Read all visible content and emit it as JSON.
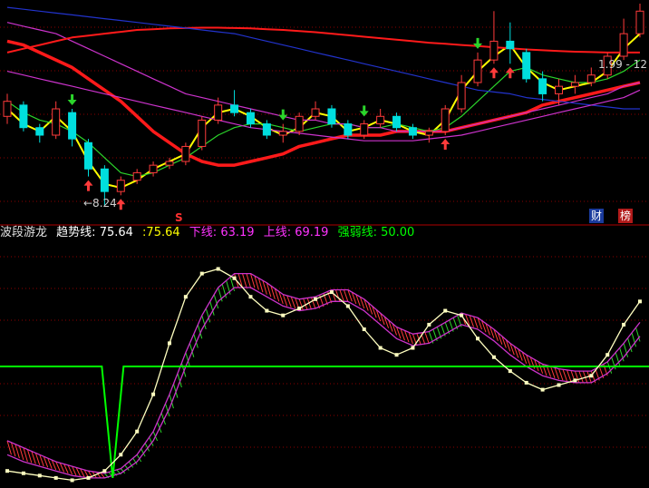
{
  "indicator": {
    "name": "波段游龙",
    "trend_label": "趋势线:",
    "trend_value": "75.64",
    "trend_value2": ":75.64",
    "lower_label": "下线:",
    "lower_value": "63.19",
    "upper_label": "上线:",
    "upper_value": "69.19",
    "strength_label": "强弱线:",
    "strength_value": "50.00"
  },
  "badges": {
    "cai": "财",
    "bang": "榜"
  },
  "price_panel": {
    "low_annotation": "←8.24",
    "right_annotation": "1.99 - 12",
    "s_marker": "S"
  },
  "colors": {
    "background": "#000000",
    "grid_red": "#8b0000",
    "ma_red": "#ff1a1a",
    "ma_yellow": "#ffff00",
    "ma_green": "#2bd52b",
    "ma_magenta": "#cc33cc",
    "ma_blue": "#2233cc",
    "up_candle": "#ff3b3b",
    "down_candle": "#00dede",
    "trend_line": "#ffffc0",
    "band": "#cc33cc",
    "strength_line": "#00ff00"
  },
  "chart_data": [
    {
      "type": "line",
      "title": "",
      "series": [
        {
          "values": [
            12.6,
            12.5,
            12.3,
            12.1,
            11.9,
            11.6,
            11.3,
            11.0,
            10.6,
            10.2,
            9.9,
            9.6,
            9.4,
            9.3,
            9.3,
            9.4,
            9.5,
            9.6,
            9.8,
            9.9,
            10.0,
            10.1,
            10.1,
            10.1,
            10.2,
            10.2,
            10.2,
            10.2,
            10.3,
            10.4,
            10.5,
            10.6,
            10.7,
            10.9,
            11.0,
            11.1,
            11.2,
            11.3,
            11.4,
            11.5
          ]
        },
        {
          "values": [
            10.8,
            10.4,
            10.2,
            10.6,
            10.2,
            9.4,
            8.8,
            8.7,
            8.9,
            9.2,
            9.4,
            9.6,
            10.3,
            10.7,
            10.8,
            10.6,
            10.3,
            10.1,
            10.3,
            10.7,
            10.6,
            10.2,
            10.3,
            10.5,
            10.4,
            10.2,
            10.1,
            10.5,
            11.3,
            11.8,
            12.2,
            12.5,
            11.9,
            11.5,
            11.3,
            11.4,
            11.5,
            11.8,
            12.4,
            12.8
          ]
        },
        {
          "values": [
            11.0,
            10.7,
            10.5,
            10.4,
            10.2,
            9.9,
            9.5,
            9.1,
            9.0,
            9.1,
            9.3,
            9.5,
            9.8,
            10.1,
            10.3,
            10.4,
            10.4,
            10.3,
            10.2,
            10.3,
            10.4,
            10.4,
            10.3,
            10.3,
            10.4,
            10.3,
            10.2,
            10.3,
            10.6,
            11.0,
            11.4,
            11.8,
            11.9,
            11.7,
            11.6,
            11.5,
            11.5,
            11.6,
            11.8,
            12.1
          ]
        },
        {
          "values": [
            13.1,
            13.0,
            12.9,
            12.8,
            12.6,
            12.4,
            12.2,
            12.0,
            11.8,
            11.6,
            11.4,
            11.2,
            11.1,
            11.0,
            10.9,
            10.8,
            10.7,
            10.6,
            10.5,
            10.5,
            10.4,
            10.4,
            10.3,
            10.3,
            10.2,
            10.2,
            10.2,
            10.2,
            10.3,
            10.4,
            10.5,
            10.6,
            10.7,
            10.8,
            10.9,
            11.0,
            11.1,
            11.2,
            11.4,
            11.5
          ]
        },
        {
          "values": [
            12.3,
            12.4,
            12.5,
            12.6,
            12.7,
            12.75,
            12.8,
            12.85,
            12.9,
            12.92,
            12.94,
            12.95,
            12.96,
            12.96,
            12.95,
            12.94,
            12.92,
            12.9,
            12.87,
            12.84,
            12.8,
            12.76,
            12.72,
            12.68,
            12.64,
            12.6,
            12.56,
            12.53,
            12.5,
            12.47,
            12.44,
            12.41,
            12.38,
            12.36,
            12.34,
            12.32,
            12.31,
            12.3,
            12.3,
            12.3
          ]
        },
        {
          "values": [
            13.5,
            13.45,
            13.4,
            13.35,
            13.3,
            13.25,
            13.2,
            13.15,
            13.1,
            13.05,
            13.0,
            12.95,
            12.9,
            12.85,
            12.8,
            12.7,
            12.6,
            12.5,
            12.4,
            12.3,
            12.2,
            12.1,
            12.0,
            11.9,
            11.8,
            11.7,
            11.6,
            11.5,
            11.4,
            11.3,
            11.25,
            11.2,
            11.1,
            11.05,
            11.0,
            10.95,
            10.9,
            10.85,
            10.8,
            10.8
          ]
        },
        {
          "values": [
            11.8,
            11.7,
            11.6,
            11.5,
            11.4,
            11.3,
            11.2,
            11.1,
            11.0,
            10.9,
            10.8,
            10.7,
            10.6,
            10.5,
            10.4,
            10.3,
            10.25,
            10.2,
            10.15,
            10.1,
            10.05,
            10.0,
            9.95,
            9.95,
            9.95,
            9.95,
            10.0,
            10.05,
            10.1,
            10.2,
            10.3,
            10.4,
            10.5,
            10.6,
            10.7,
            10.8,
            10.9,
            11.0,
            11.1,
            11.3
          ]
        }
      ],
      "candles": [
        {
          "o": 10.6,
          "c": 11.0,
          "h": 11.2,
          "l": 10.4
        },
        {
          "o": 10.9,
          "c": 10.3,
          "h": 11.0,
          "l": 10.2
        },
        {
          "o": 10.3,
          "c": 10.1,
          "h": 10.4,
          "l": 9.9
        },
        {
          "o": 10.1,
          "c": 10.8,
          "h": 11.0,
          "l": 10.0
        },
        {
          "o": 10.7,
          "c": 10.0,
          "h": 10.8,
          "l": 9.8
        },
        {
          "o": 9.9,
          "c": 9.2,
          "h": 10.0,
          "l": 9.0
        },
        {
          "o": 9.2,
          "c": 8.6,
          "h": 9.3,
          "l": 8.24
        },
        {
          "o": 8.6,
          "c": 8.9,
          "h": 9.0,
          "l": 8.5
        },
        {
          "o": 8.9,
          "c": 9.1,
          "h": 9.2,
          "l": 8.8
        },
        {
          "o": 9.1,
          "c": 9.3,
          "h": 9.4,
          "l": 9.0
        },
        {
          "o": 9.3,
          "c": 9.4,
          "h": 9.5,
          "l": 9.2
        },
        {
          "o": 9.4,
          "c": 9.8,
          "h": 9.9,
          "l": 9.3
        },
        {
          "o": 9.8,
          "c": 10.5,
          "h": 10.6,
          "l": 9.7
        },
        {
          "o": 10.5,
          "c": 10.9,
          "h": 11.1,
          "l": 10.4
        },
        {
          "o": 10.9,
          "c": 10.7,
          "h": 11.3,
          "l": 10.6
        },
        {
          "o": 10.7,
          "c": 10.4,
          "h": 10.8,
          "l": 10.3
        },
        {
          "o": 10.4,
          "c": 10.1,
          "h": 10.5,
          "l": 10.0
        },
        {
          "o": 10.1,
          "c": 10.2,
          "h": 10.4,
          "l": 9.9
        },
        {
          "o": 10.2,
          "c": 10.6,
          "h": 10.7,
          "l": 10.1
        },
        {
          "o": 10.6,
          "c": 10.8,
          "h": 11.0,
          "l": 10.5
        },
        {
          "o": 10.8,
          "c": 10.4,
          "h": 10.9,
          "l": 10.3
        },
        {
          "o": 10.4,
          "c": 10.1,
          "h": 10.5,
          "l": 10.0
        },
        {
          "o": 10.1,
          "c": 10.4,
          "h": 10.5,
          "l": 10.0
        },
        {
          "o": 10.4,
          "c": 10.6,
          "h": 10.8,
          "l": 10.3
        },
        {
          "o": 10.6,
          "c": 10.3,
          "h": 10.7,
          "l": 10.2
        },
        {
          "o": 10.3,
          "c": 10.1,
          "h": 10.4,
          "l": 10.0
        },
        {
          "o": 10.1,
          "c": 10.2,
          "h": 10.3,
          "l": 9.9
        },
        {
          "o": 10.2,
          "c": 10.8,
          "h": 10.9,
          "l": 10.1
        },
        {
          "o": 10.8,
          "c": 11.5,
          "h": 11.7,
          "l": 10.7
        },
        {
          "o": 11.5,
          "c": 12.1,
          "h": 12.3,
          "l": 11.4
        },
        {
          "o": 12.1,
          "c": 12.6,
          "h": 13.4,
          "l": 12.0
        },
        {
          "o": 12.6,
          "c": 12.4,
          "h": 13.1,
          "l": 12.0
        },
        {
          "o": 12.3,
          "c": 11.6,
          "h": 12.4,
          "l": 11.5
        },
        {
          "o": 11.6,
          "c": 11.2,
          "h": 11.8,
          "l": 11.0
        },
        {
          "o": 11.2,
          "c": 11.4,
          "h": 11.6,
          "l": 10.9
        },
        {
          "o": 11.4,
          "c": 11.5,
          "h": 11.7,
          "l": 11.2
        },
        {
          "o": 11.5,
          "c": 11.7,
          "h": 11.9,
          "l": 11.4
        },
        {
          "o": 11.7,
          "c": 12.2,
          "h": 12.3,
          "l": 11.6
        },
        {
          "o": 12.2,
          "c": 12.8,
          "h": 13.2,
          "l": 12.1
        },
        {
          "o": 12.8,
          "c": 13.4,
          "h": 13.6,
          "l": 12.7
        }
      ],
      "buy_signals": [
        5,
        7,
        27,
        30,
        31
      ],
      "sell_signals": [
        4,
        17,
        22,
        29
      ]
    },
    {
      "type": "line",
      "title": "",
      "ylim": [
        0,
        100
      ],
      "series": [
        {
          "name": "趋势线",
          "values": [
            5,
            4,
            3,
            2,
            1,
            2,
            5,
            12,
            22,
            38,
            60,
            80,
            90,
            92,
            88,
            80,
            74,
            72,
            75,
            79,
            82,
            76,
            66,
            58,
            55,
            58,
            68,
            74,
            72,
            62,
            54,
            48,
            43,
            40,
            42,
            44,
            46,
            55,
            68,
            78
          ]
        },
        {
          "name": "下线",
          "values": [
            12,
            9,
            7,
            5,
            3,
            2,
            2,
            4,
            9,
            18,
            32,
            50,
            66,
            78,
            84,
            84,
            80,
            76,
            74,
            75,
            78,
            78,
            74,
            68,
            62,
            59,
            60,
            64,
            68,
            66,
            61,
            55,
            50,
            46,
            44,
            43,
            43,
            47,
            54,
            63
          ]
        },
        {
          "name": "上线",
          "values": [
            18,
            15,
            12,
            9,
            7,
            5,
            4,
            6,
            12,
            22,
            38,
            56,
            72,
            84,
            90,
            90,
            86,
            81,
            79,
            80,
            83,
            83,
            79,
            73,
            67,
            64,
            65,
            69,
            73,
            71,
            66,
            60,
            55,
            51,
            49,
            48,
            48,
            52,
            60,
            69
          ]
        },
        {
          "name": "强弱线",
          "values": [
            50,
            50,
            50,
            50,
            50,
            50,
            50,
            50,
            50,
            50,
            50,
            50,
            50,
            50,
            50,
            50,
            50,
            50,
            50,
            50,
            50,
            50,
            50,
            50,
            50,
            50,
            50,
            50,
            50,
            50,
            50,
            50,
            50,
            50,
            50,
            50,
            50,
            50,
            50,
            50
          ]
        }
      ]
    }
  ]
}
